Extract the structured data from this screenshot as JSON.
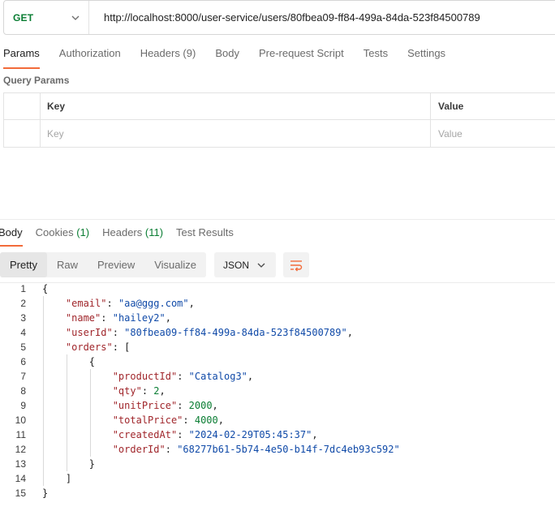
{
  "request": {
    "method": "GET",
    "url": "http://localhost:8000/user-service/users/80fbea09-ff84-499a-84da-523f84500789",
    "tabs": [
      {
        "label": "Params",
        "active": true
      },
      {
        "label": "Authorization",
        "active": false
      },
      {
        "label": "Headers (9)",
        "active": false
      },
      {
        "label": "Body",
        "active": false
      },
      {
        "label": "Pre-request Script",
        "active": false
      },
      {
        "label": "Tests",
        "active": false
      },
      {
        "label": "Settings",
        "active": false
      }
    ]
  },
  "query_params": {
    "title": "Query Params",
    "columns": {
      "key": "Key",
      "value": "Value"
    },
    "placeholder": {
      "key": "Key",
      "value": "Value"
    }
  },
  "response": {
    "tabs": [
      {
        "label": "Body",
        "count": "",
        "active": true
      },
      {
        "label": "Cookies",
        "count": "(1)",
        "active": false
      },
      {
        "label": "Headers",
        "count": "(11)",
        "active": false
      },
      {
        "label": "Test Results",
        "count": "",
        "active": false
      }
    ],
    "views": [
      {
        "label": "Pretty",
        "selected": true
      },
      {
        "label": "Raw",
        "selected": false
      },
      {
        "label": "Preview",
        "selected": false
      },
      {
        "label": "Visualize",
        "selected": false
      }
    ],
    "format": "JSON",
    "body_lines": [
      [
        [
          "p",
          "{"
        ]
      ],
      [
        [
          "p",
          "    "
        ],
        [
          "k",
          "\"email\""
        ],
        [
          "p",
          ": "
        ],
        [
          "s",
          "\"aa@ggg.com\""
        ],
        [
          "p",
          ","
        ]
      ],
      [
        [
          "p",
          "    "
        ],
        [
          "k",
          "\"name\""
        ],
        [
          "p",
          ": "
        ],
        [
          "s",
          "\"hailey2\""
        ],
        [
          "p",
          ","
        ]
      ],
      [
        [
          "p",
          "    "
        ],
        [
          "k",
          "\"userId\""
        ],
        [
          "p",
          ": "
        ],
        [
          "s",
          "\"80fbea09-ff84-499a-84da-523f84500789\""
        ],
        [
          "p",
          ","
        ]
      ],
      [
        [
          "p",
          "    "
        ],
        [
          "k",
          "\"orders\""
        ],
        [
          "p",
          ": ["
        ]
      ],
      [
        [
          "p",
          "        {"
        ]
      ],
      [
        [
          "p",
          "            "
        ],
        [
          "k",
          "\"productId\""
        ],
        [
          "p",
          ": "
        ],
        [
          "s",
          "\"Catalog3\""
        ],
        [
          "p",
          ","
        ]
      ],
      [
        [
          "p",
          "            "
        ],
        [
          "k",
          "\"qty\""
        ],
        [
          "p",
          ": "
        ],
        [
          "n",
          "2"
        ],
        [
          "p",
          ","
        ]
      ],
      [
        [
          "p",
          "            "
        ],
        [
          "k",
          "\"unitPrice\""
        ],
        [
          "p",
          ": "
        ],
        [
          "n",
          "2000"
        ],
        [
          "p",
          ","
        ]
      ],
      [
        [
          "p",
          "            "
        ],
        [
          "k",
          "\"totalPrice\""
        ],
        [
          "p",
          ": "
        ],
        [
          "n",
          "4000"
        ],
        [
          "p",
          ","
        ]
      ],
      [
        [
          "p",
          "            "
        ],
        [
          "k",
          "\"createdAt\""
        ],
        [
          "p",
          ": "
        ],
        [
          "s",
          "\"2024-02-29T05:45:37\""
        ],
        [
          "p",
          ","
        ]
      ],
      [
        [
          "p",
          "            "
        ],
        [
          "k",
          "\"orderId\""
        ],
        [
          "p",
          ": "
        ],
        [
          "s",
          "\"68277b61-5b74-4e50-b14f-7dc4eb93c592\""
        ]
      ],
      [
        [
          "p",
          "        }"
        ]
      ],
      [
        [
          "p",
          "    ]"
        ]
      ],
      [
        [
          "p",
          "}"
        ]
      ]
    ]
  },
  "colors": {
    "accent": "#f26b3a",
    "method_get": "#0a7d33",
    "json_key": "#a0262b",
    "json_string": "#104aa8",
    "json_number": "#0a7d33"
  }
}
